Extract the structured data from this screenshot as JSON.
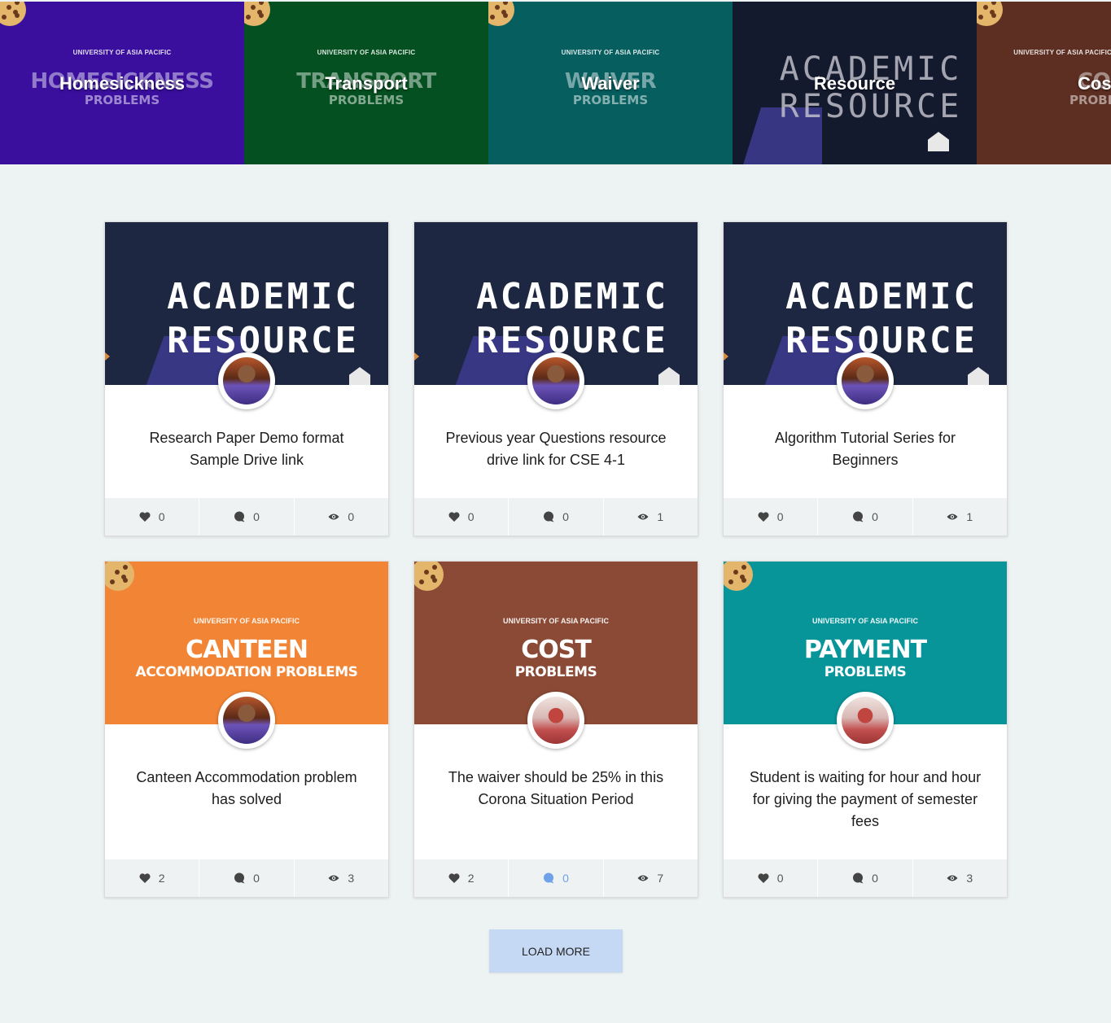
{
  "categories": [
    {
      "name": "Homesickness",
      "poster_uni": "UNIVERSITY OF ASIA PACIFIC",
      "poster_big": "HOMESICKNESS",
      "poster_sub": "PROBLEMS",
      "bg": "#3a0f9e"
    },
    {
      "name": "Transport",
      "poster_uni": "UNIVERSITY OF ASIA PACIFIC",
      "poster_big": "TRANSPORT",
      "poster_sub": "PROBLEMS",
      "bg": "#055020"
    },
    {
      "name": "Waiver",
      "poster_uni": "UNIVERSITY OF ASIA PACIFIC",
      "poster_big": "WAIVER",
      "poster_sub": "PROBLEMS",
      "bg": "#065e5f"
    },
    {
      "name": "Resource",
      "poster_line1": "ACADEMIC",
      "poster_line2": "RESOURCE",
      "bg": "#141a2e"
    },
    {
      "name": "Cost",
      "poster_uni": "UNIVERSITY OF ASIA PACIFIC",
      "poster_big": "COST",
      "poster_sub": "PROBLEMS",
      "bg": "#5c2f22"
    }
  ],
  "cards": [
    {
      "poster": "academic",
      "poster_line1": "ACADEMIC",
      "poster_line2": "RESOURCE",
      "title": "Research Paper Demo format Sample Drive link",
      "likes": "0",
      "comments": "0",
      "views": "0"
    },
    {
      "poster": "academic",
      "poster_line1": "ACADEMIC",
      "poster_line2": "RESOURCE",
      "title": "Previous year Questions resource drive link for CSE 4-1",
      "likes": "0",
      "comments": "0",
      "views": "1"
    },
    {
      "poster": "academic",
      "poster_line1": "ACADEMIC",
      "poster_line2": "RESOURCE",
      "title": "Algorithm Tutorial Series for Beginners",
      "likes": "0",
      "comments": "0",
      "views": "1"
    },
    {
      "poster": "uap",
      "poster_uni": "UNIVERSITY OF ASIA PACIFIC",
      "poster_big": "CANTEEN",
      "poster_sub": "ACCOMMODATION PROBLEMS",
      "bg": "#f28535",
      "title": "Canteen Accommodation problem has solved",
      "likes": "2",
      "comments": "0",
      "views": "3"
    },
    {
      "poster": "uap",
      "poster_uni": "UNIVERSITY OF ASIA PACIFIC",
      "poster_big": "COST",
      "poster_sub": "PROBLEMS",
      "bg": "#8a4a35",
      "title": "The waiver should be 25% in this Corona Situation Period",
      "likes": "2",
      "comments": "0",
      "views": "7"
    },
    {
      "poster": "uap",
      "poster_uni": "UNIVERSITY OF ASIA PACIFIC",
      "poster_big": "PAYMENT",
      "poster_sub": "PROBLEMS",
      "bg": "#07959a",
      "title": "Student is waiting for hour and hour for giving the payment of semester fees",
      "likes": "0",
      "comments": "0",
      "views": "3"
    }
  ],
  "icons": {
    "like": "heart-icon",
    "comment": "comment-icon",
    "view": "eye-icon"
  },
  "colors": {
    "page_bg": "#edf2f2",
    "active_comment": "#6ea1e8",
    "load_more_bg": "#c6d9f4"
  },
  "load_more_label": "LOAD MORE"
}
